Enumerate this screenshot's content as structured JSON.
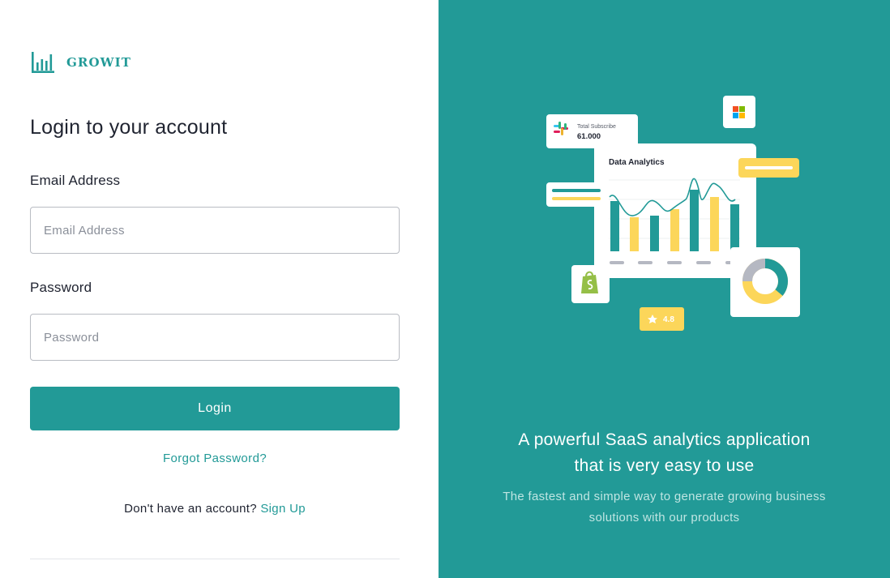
{
  "brand": {
    "name": "GROWIT",
    "icon": "bar-chart-logo-icon",
    "color": "#229a97"
  },
  "login_form": {
    "title": "Login to your account",
    "email_label": "Email Address",
    "email_placeholder": "Email Address",
    "email_value": "",
    "password_label": "Password",
    "password_placeholder": "Password",
    "password_value": "",
    "login_button": "Login",
    "forgot_password": "Forgot Password?",
    "no_account_text": "Don't have an account?",
    "signup_link": "Sign Up"
  },
  "promo": {
    "background": "#229a97",
    "headline_line1": "A powerful SaaS analytics application",
    "headline_line2": "that is very easy to use",
    "sub_line1": "The fastest and simple way to generate growing business",
    "sub_line2": "solutions with our products",
    "illustration": {
      "subscribe_label": "Total Subscribe",
      "subscribe_value": "61.000",
      "chart_title": "Data Analytics",
      "rating": "4.8",
      "icons": [
        "slack-icon",
        "microsoft-icon",
        "shopify-icon",
        "star-icon",
        "donut-chart-icon"
      ]
    }
  }
}
